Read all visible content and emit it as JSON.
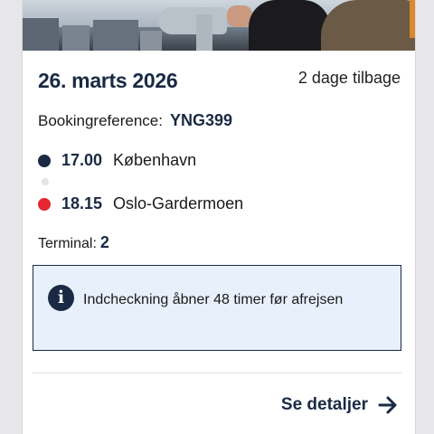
{
  "booking": {
    "date": "26. marts 2026",
    "relative": "2 dage tilbage",
    "reference_label": "Bookingreference:",
    "reference": "YNG399",
    "departure": {
      "time": "17.00",
      "city": "København",
      "color": "#1a2a44"
    },
    "arrival": {
      "time": "18.15",
      "city": "Oslo-Gardermoen",
      "color": "#e3262f"
    },
    "terminal_label": "Terminal:",
    "terminal": "2",
    "info_text": "Indcheckning åbner 48 timer før afrejsen",
    "info_icon": "info-icon",
    "details_label": "Se detaljer",
    "details_icon": "arrow-right-icon"
  },
  "colors": {
    "primary": "#1a2a44",
    "accent_red": "#e3262f",
    "info_bg": "#e7f0fb"
  }
}
